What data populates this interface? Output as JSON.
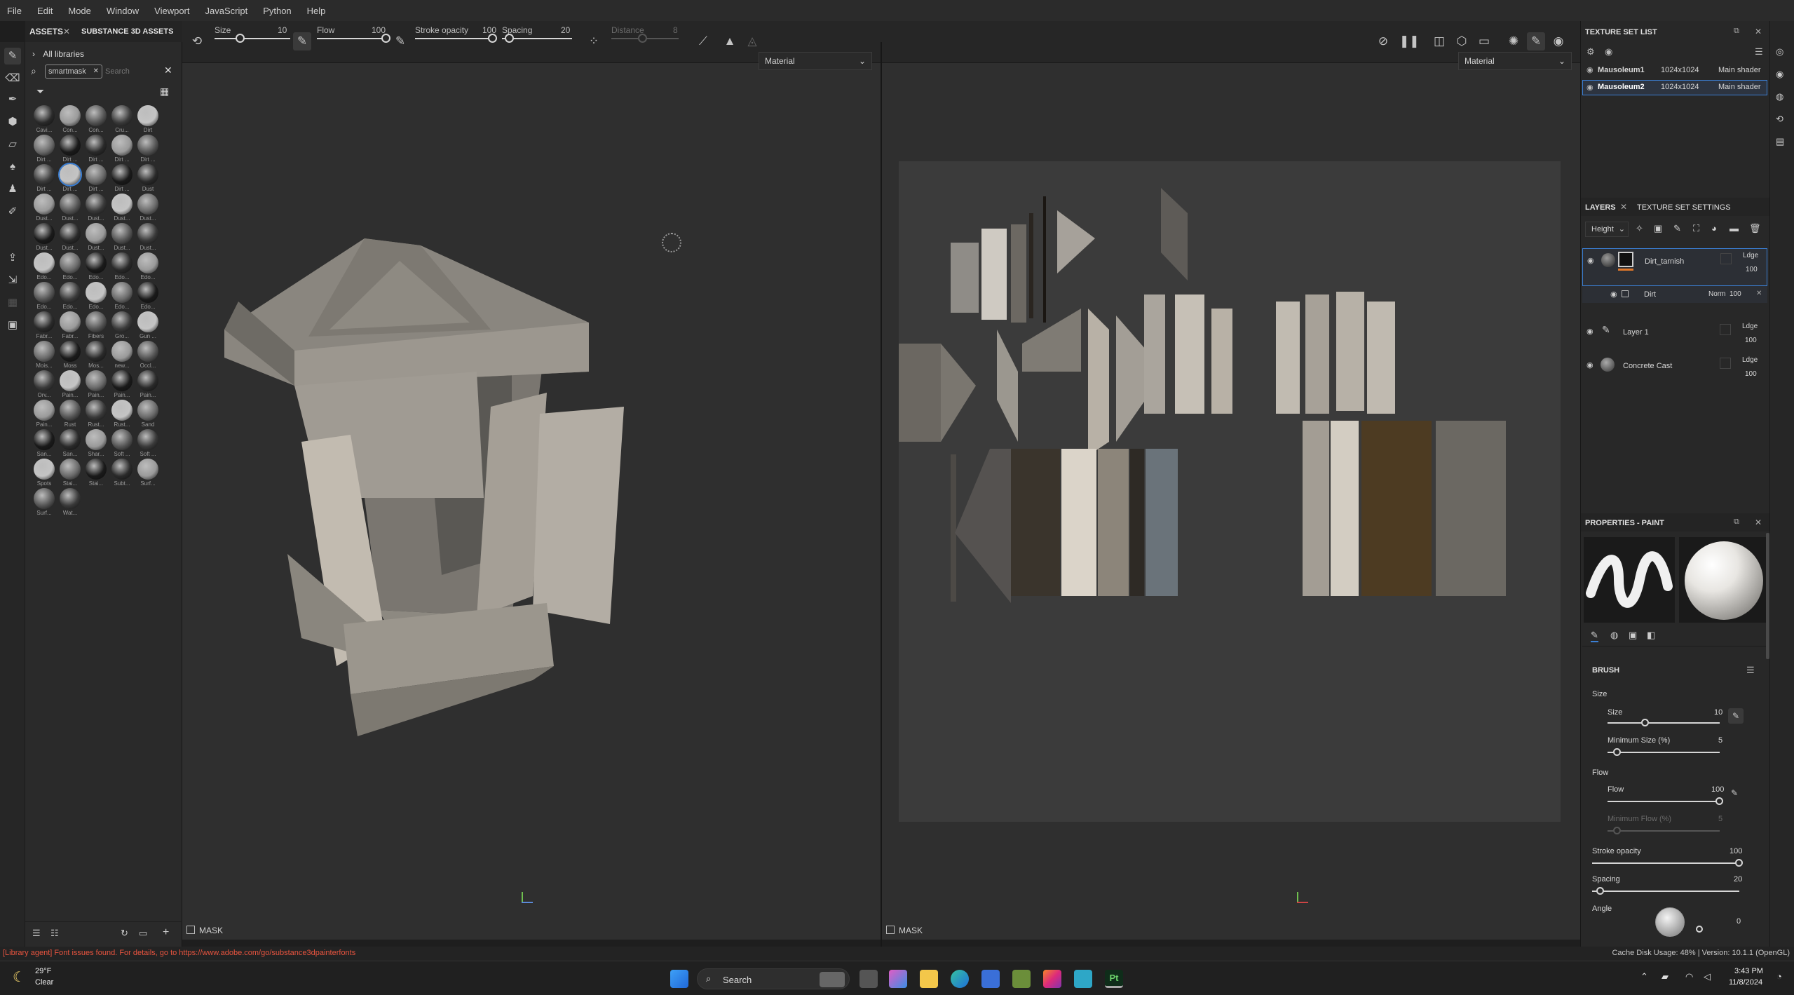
{
  "menu": [
    "File",
    "Edit",
    "Mode",
    "Window",
    "Viewport",
    "JavaScript",
    "Python",
    "Help"
  ],
  "toolbar": {
    "size_label": "Size",
    "size_value": "10",
    "flow_label": "Flow",
    "flow_value": "100",
    "stroke_label": "Stroke opacity",
    "stroke_value": "100",
    "spacing_label": "Spacing",
    "spacing_value": "20",
    "distance_label": "Distance",
    "distance_value": "8"
  },
  "assets": {
    "tab_assets": "ASSETS",
    "tab_substance": "SUBSTANCE 3D ASSETS",
    "libraries": "All libraries",
    "search_tag": "smartmask",
    "search_placeholder": "Search",
    "thumbs": [
      "Cavi...",
      "Con...",
      "Con...",
      "Cru...",
      "Dirt",
      "Dirt ...",
      "Dirt ...",
      "Dirt ...",
      "Dirt ...",
      "Dirt ...",
      "Dirt ...",
      "Dirt ...",
      "Dirt ...",
      "Dirt ...",
      "Dust",
      "Dust...",
      "Dust...",
      "Dust...",
      "Dust...",
      "Dust...",
      "Dust...",
      "Dust...",
      "Dust...",
      "Dust...",
      "Dust...",
      "Edo...",
      "Edo...",
      "Edo...",
      "Edo...",
      "Edo...",
      "Edo...",
      "Edo...",
      "Edo...",
      "Edo...",
      "Edo...",
      "Fabr...",
      "Fabr...",
      "Fibers",
      "Gro...",
      "Gun ...",
      "Mois...",
      "Moss",
      "Mos...",
      "new...",
      "Occl...",
      "Orv...",
      "Pain...",
      "Pain...",
      "Pain...",
      "Pain...",
      "Pain...",
      "Rust",
      "Rust...",
      "Rust...",
      "Sand",
      "San...",
      "San...",
      "Shar...",
      "Soft ...",
      "Soft ...",
      "Spots",
      "Stai...",
      "Stai...",
      "Subt...",
      "Surf...",
      "Surf...",
      "Wat..."
    ]
  },
  "viewport": {
    "left_mode": "Material",
    "right_mode": "Material",
    "mask_left": "MASK",
    "mask_right": "MASK"
  },
  "texture_set_list": {
    "title": "TEXTURE SET LIST",
    "rows": [
      {
        "name": "Mausoleum1",
        "res": "1024x1024",
        "shader": "Main shader"
      },
      {
        "name": "Mausoleum2",
        "res": "1024x1024",
        "shader": "Main shader"
      }
    ]
  },
  "layers": {
    "tab_layers": "LAYERS",
    "tab_settings": "TEXTURE SET SETTINGS",
    "channel": "Height",
    "items": [
      {
        "name": "Dirt_tarnish",
        "blend": "Ldge",
        "opacity": "100"
      },
      {
        "name": "Dirt",
        "blend": "Norm",
        "opacity": "100"
      },
      {
        "name": "Layer 1",
        "blend": "Ldge",
        "opacity": "100"
      },
      {
        "name": "Concrete Cast",
        "blend": "Ldge",
        "opacity": "100"
      }
    ]
  },
  "properties": {
    "title": "PROPERTIES - PAINT",
    "brush_header": "BRUSH",
    "size_group": "Size",
    "size_label": "Size",
    "size_value": "10",
    "minsize_label": "Minimum Size (%)",
    "minsize_value": "5",
    "flow_group": "Flow",
    "flow_label": "Flow",
    "flow_value": "100",
    "minflow_label": "Minimum Flow (%)",
    "minflow_value": "5",
    "stroke_label": "Stroke opacity",
    "stroke_value": "100",
    "spacing_label": "Spacing",
    "spacing_value": "20",
    "angle_label": "Angle",
    "angle_value": "0"
  },
  "status": {
    "message": "[Library agent] Font issues found. For details, go to https://www.adobe.com/go/substance3dpainterfonts",
    "cache": "Cache Disk Usage:  48% | Version: 10.1.1 (OpenGL)"
  },
  "taskbar": {
    "temp": "29°F",
    "weather": "Clear",
    "search": "Search",
    "time": "3:43 PM",
    "date": "11/8/2024",
    "app": "Pt"
  },
  "colors": {
    "accent": "#3b7fd4",
    "status_error": "#e8543f",
    "layer_orange": "#e0782a"
  }
}
